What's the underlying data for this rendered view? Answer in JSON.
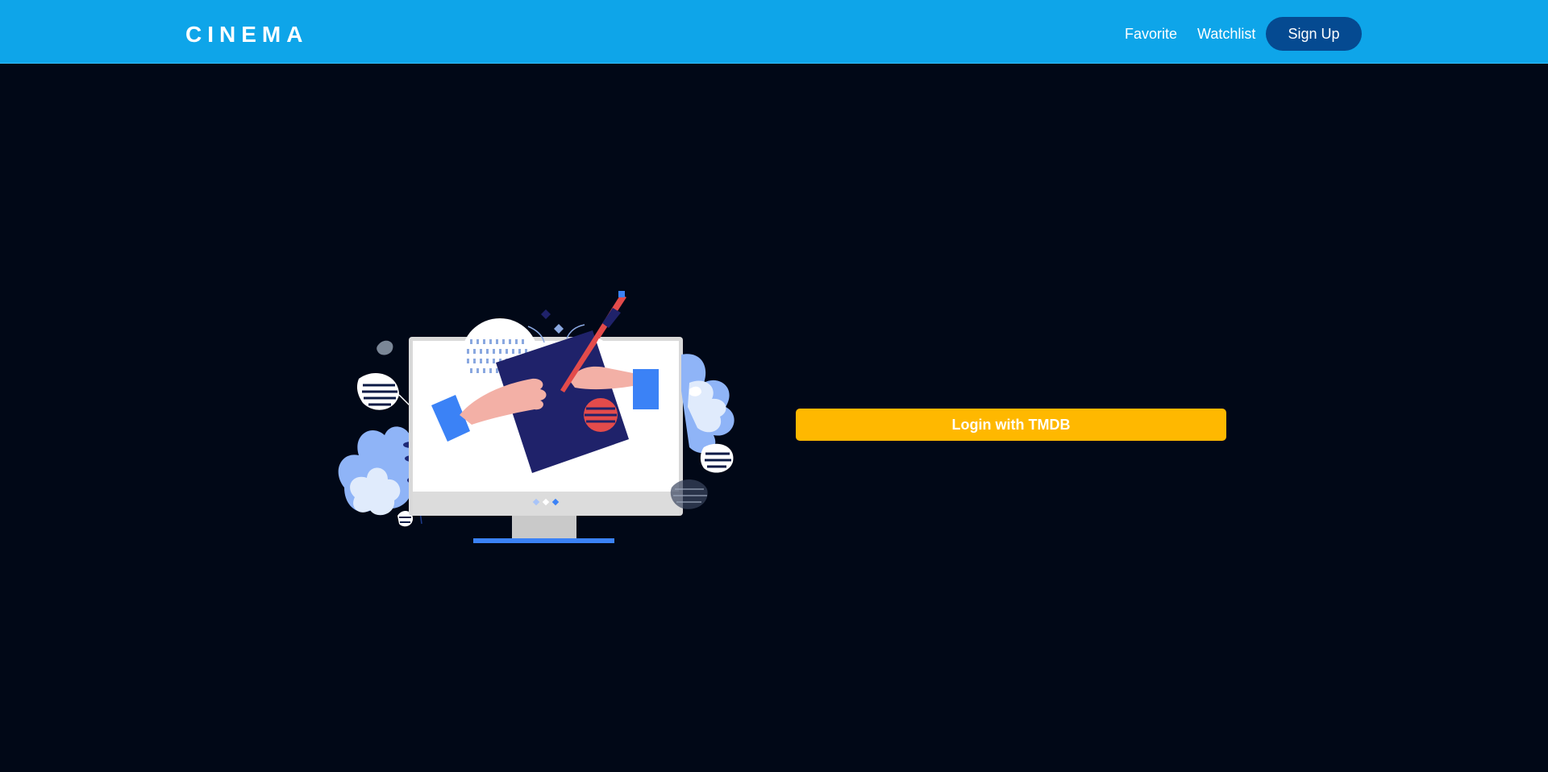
{
  "navbar": {
    "brand": "CINEMA",
    "links": [
      {
        "label": "Favorite"
      },
      {
        "label": "Watchlist"
      }
    ],
    "signup_label": "Sign Up"
  },
  "main": {
    "illustration_icon": "computer-design-illustration",
    "login_label": "Login with TMDB"
  },
  "colors": {
    "navbar": "#0ea5e9",
    "signup": "#054a91",
    "background": "#010817",
    "login": "#ffb800"
  }
}
